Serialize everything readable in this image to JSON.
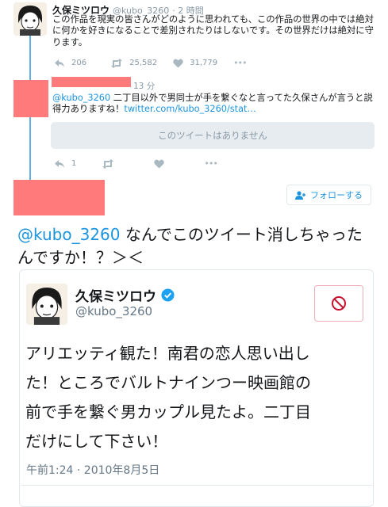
{
  "tweet1": {
    "name": "久保ミツロウ",
    "handle": "@kubo_3260",
    "time": "· 2 時間",
    "text_line1": "この作品を現実の皆さんがどのように思われても、この作品の世界の中では絶対",
    "text_line2": "に何かを好きになることで差別されたりはしないです。その世界だけは絶対に守",
    "text_line3": "ります。",
    "replies": "206",
    "retweets": "25,582",
    "likes": "31,779",
    "more": "•••"
  },
  "tweet2": {
    "time": "13 分",
    "mention": "@kubo_3260",
    "text_line1_rest": " 二丁目以外で男同士が手を繋ぐなと言ってた久保さんが言うと説",
    "text_line2": "得力ありますね！",
    "link": "twitter.com/kubo_3260/stat…",
    "unavailable": "このツイートはありません",
    "replies": "1",
    "more": "•••"
  },
  "follow_button": "フォローする",
  "comment": {
    "mention": "@kubo_3260",
    "line1_rest": " なんでこのツイート消しちゃった",
    "line2": "んですか！？＞＜"
  },
  "card": {
    "name": "久保ミツロウ",
    "handle": "@kubo_3260",
    "text_line1": "アリエッティ観た！南君の恋人思い出し",
    "text_line2": "た！ところでバルトナインつー映画館の",
    "text_line3": "前で手を繋ぐ男カップル見たよ。二丁目",
    "text_line4": "だけにして下さい！",
    "timestamp": "午前1:24 · 2010年8月5日"
  },
  "colors": {
    "accent": "#1b95e0",
    "thread_line": "#5fb2e3",
    "redaction": "#ff7b7b",
    "verified": "#1da1f2",
    "block": "#c8102e"
  },
  "icons": [
    "reply-icon",
    "retweet-icon",
    "like-icon",
    "more-icon",
    "follow-person-icon",
    "verified-icon",
    "block-icon"
  ]
}
